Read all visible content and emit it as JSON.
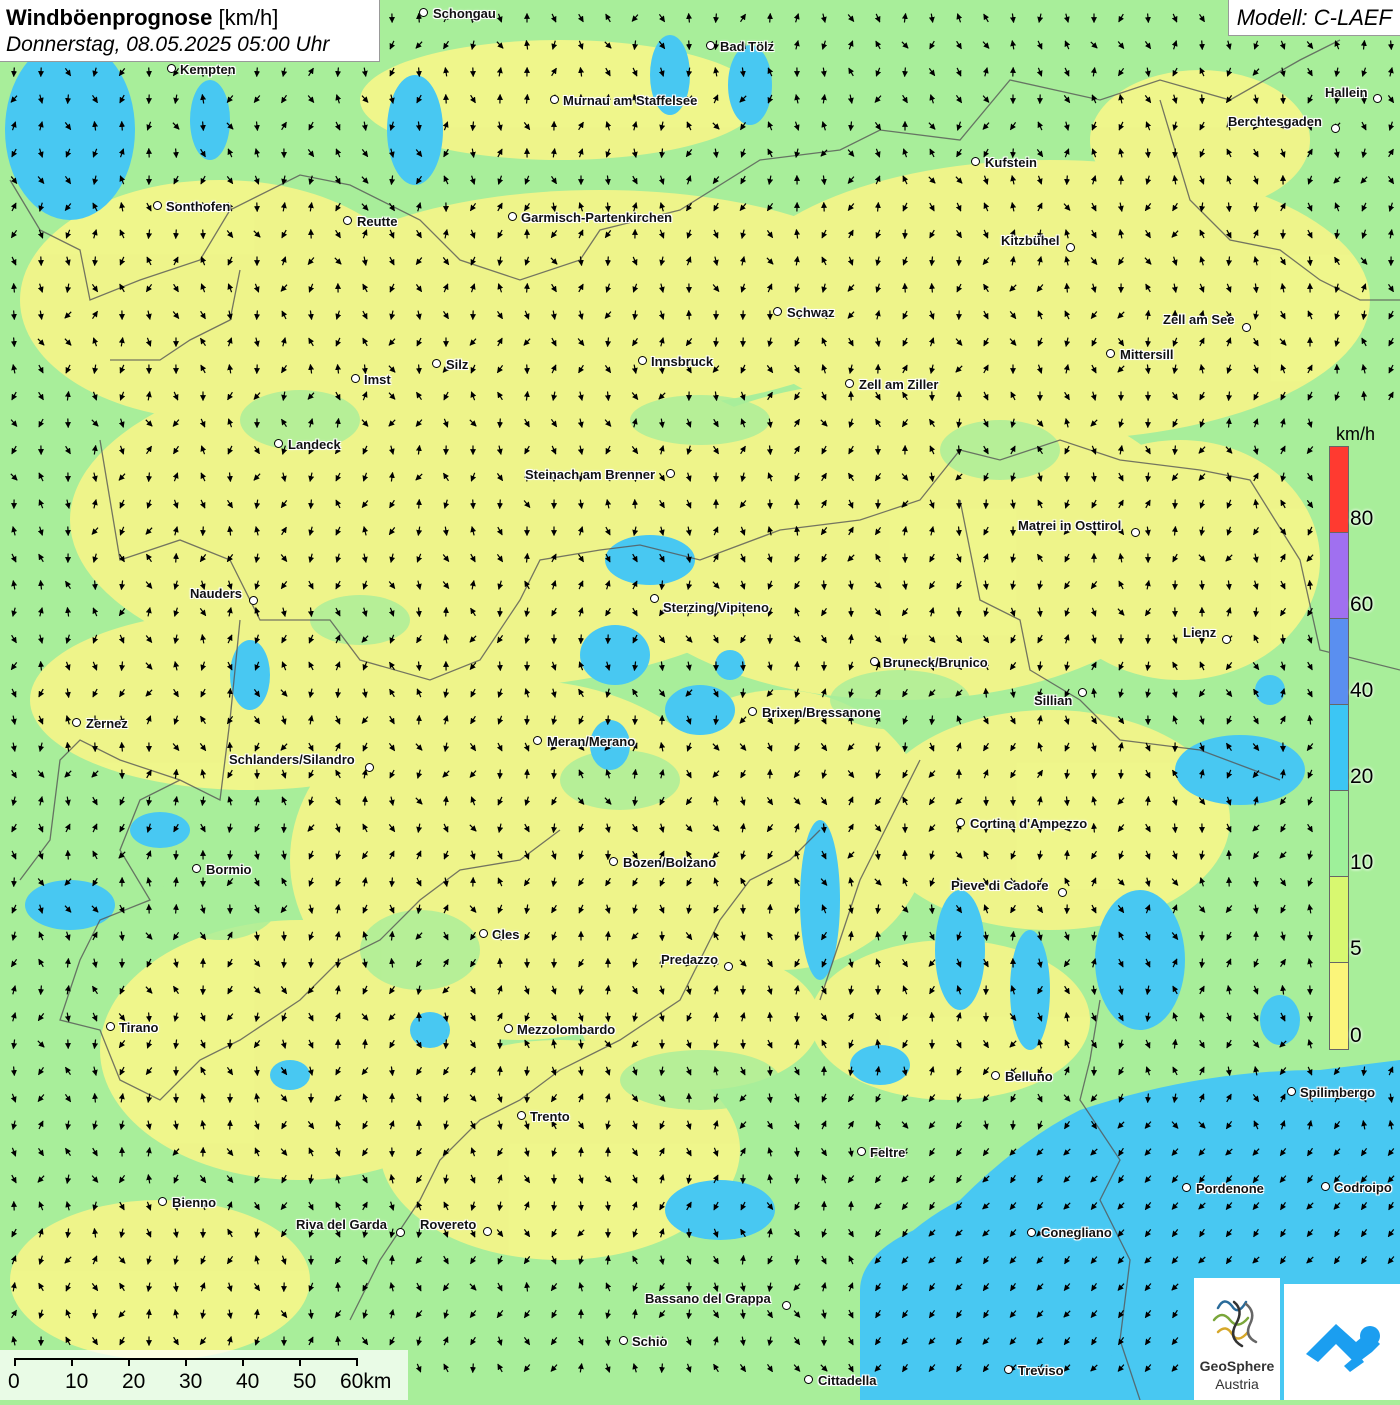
{
  "title": {
    "main": "Windböenprognose",
    "unit": "[km/h]",
    "datetime": "Donnerstag, 08.05.2025 05:00 Uhr"
  },
  "model": "Modell: C-LAEF",
  "cities": [
    {
      "name": "Schongau"
    },
    {
      "name": "Bad Tölz"
    },
    {
      "name": "Kempten"
    },
    {
      "name": "Murnau am Staffelsee"
    },
    {
      "name": "Hallein"
    },
    {
      "name": "Berchtesgaden"
    },
    {
      "name": "Kufstein"
    },
    {
      "name": "Sonthofen"
    },
    {
      "name": "Reutte"
    },
    {
      "name": "Garmisch-Partenkirchen"
    },
    {
      "name": "Kitzbühel"
    },
    {
      "name": "Schwaz"
    },
    {
      "name": "Zell am See"
    },
    {
      "name": "Mittersill"
    },
    {
      "name": "Silz"
    },
    {
      "name": "Innsbruck"
    },
    {
      "name": "Imst"
    },
    {
      "name": "Zell am Ziller"
    },
    {
      "name": "Landeck"
    },
    {
      "name": "Steinach am Brenner"
    },
    {
      "name": "Matrei in Osttirol"
    },
    {
      "name": "Nauders"
    },
    {
      "name": "Sterzing/Vipiteno"
    },
    {
      "name": "Lienz"
    },
    {
      "name": "Bruneck/Brunico"
    },
    {
      "name": "Sillian"
    },
    {
      "name": "Zernez"
    },
    {
      "name": "Brixen/Bressanone"
    },
    {
      "name": "Meran/Merano"
    },
    {
      "name": "Schlanders/Silandro"
    },
    {
      "name": "Cortina d'Ampezzo"
    },
    {
      "name": "Bormio"
    },
    {
      "name": "Bozen/Bolzano"
    },
    {
      "name": "Pieve di Cadore"
    },
    {
      "name": "Cles"
    },
    {
      "name": "Predazzo"
    },
    {
      "name": "Tirano"
    },
    {
      "name": "Mezzolombardo"
    },
    {
      "name": "Belluno"
    },
    {
      "name": "Spilimbergo"
    },
    {
      "name": "Trento"
    },
    {
      "name": "Feltre"
    },
    {
      "name": "Pordenone"
    },
    {
      "name": "Codroipo"
    },
    {
      "name": "Bienno"
    },
    {
      "name": "Riva del Garda"
    },
    {
      "name": "Rovereto"
    },
    {
      "name": "Conegliano"
    },
    {
      "name": "Bassano del Grappa"
    },
    {
      "name": "Schio"
    },
    {
      "name": "Treviso"
    },
    {
      "name": "Cittadella"
    }
  ],
  "legend": {
    "unit": "km/h",
    "labels": [
      "80",
      "60",
      "40",
      "20",
      "10",
      "5",
      "0"
    ],
    "colors": [
      "#ff3a30",
      "#a070f0",
      "#5a8ff0",
      "#3cc6f4",
      "#9ef09a",
      "#d8f870",
      "#fbf57a"
    ]
  },
  "scalebar": {
    "labels": [
      "0",
      "10",
      "20",
      "30",
      "40",
      "50",
      "60km"
    ]
  },
  "logos": {
    "geosphere_name": "GeoSphere",
    "geosphere_country": "Austria",
    "geosphere_icon": "geosphere-logo-icon",
    "app_icon": "weather-app-logo-icon"
  }
}
